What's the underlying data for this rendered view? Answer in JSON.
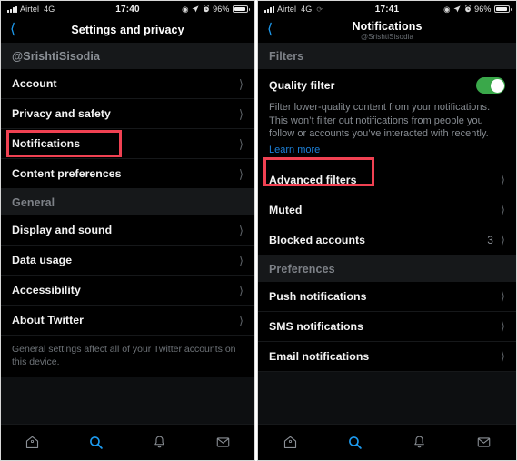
{
  "left_phone": {
    "status_bar": {
      "signal_icon": "signal-bars-icon",
      "carrier": "Airtel",
      "network": "4G",
      "time": "17:40",
      "icons": [
        "circle-icon",
        "location-arrow-icon",
        "alarm-clock-icon"
      ],
      "battery_percent": "96%",
      "battery_icon": "battery-icon"
    },
    "nav": {
      "back_icon": "chevron-left-icon",
      "title": "Settings and privacy",
      "subtitle": ""
    },
    "sections": [
      {
        "header": "@SrishtiSisodia",
        "rows": [
          {
            "label": "Account",
            "value": "",
            "accessory": "chevron-right-icon"
          },
          {
            "label": "Privacy and safety",
            "value": "",
            "accessory": "chevron-right-icon"
          },
          {
            "label": "Notifications",
            "value": "",
            "accessory": "chevron-right-icon",
            "highlighted": true
          },
          {
            "label": "Content preferences",
            "value": "",
            "accessory": "chevron-right-icon"
          }
        ]
      },
      {
        "header": "General",
        "rows": [
          {
            "label": "Display and sound",
            "value": "",
            "accessory": "chevron-right-icon"
          },
          {
            "label": "Data usage",
            "value": "",
            "accessory": "chevron-right-icon"
          },
          {
            "label": "Accessibility",
            "value": "",
            "accessory": "chevron-right-icon"
          },
          {
            "label": "About Twitter",
            "value": "",
            "accessory": "chevron-right-icon"
          }
        ]
      }
    ],
    "footer_note": "General settings affect all of your Twitter accounts on this device.",
    "tabbar": [
      {
        "icon": "home-icon",
        "active": false
      },
      {
        "icon": "search-icon",
        "active": true
      },
      {
        "icon": "bell-icon",
        "active": false
      },
      {
        "icon": "envelope-icon",
        "active": false
      }
    ]
  },
  "right_phone": {
    "status_bar": {
      "signal_icon": "signal-bars-icon",
      "carrier": "Airtel",
      "network": "4G",
      "sync_icon": "sync-icon",
      "time": "17:41",
      "icons": [
        "circle-icon",
        "location-arrow-icon",
        "alarm-clock-icon"
      ],
      "battery_percent": "96%",
      "battery_icon": "battery-icon"
    },
    "nav": {
      "back_icon": "chevron-left-icon",
      "title": "Notifications",
      "subtitle": "@SrishtiSisodia"
    },
    "filters_header": "Filters",
    "quality_filter": {
      "label": "Quality filter",
      "toggle_on": true,
      "description": "Filter lower-quality content from your notifications. This won’t filter out notifications from people you follow or accounts you’ve interacted with recently.",
      "learn_more": "Learn more"
    },
    "filter_rows": [
      {
        "label": "Advanced filters",
        "value": "",
        "accessory": "chevron-right-icon",
        "highlighted": true
      },
      {
        "label": "Muted",
        "value": "",
        "accessory": "chevron-right-icon"
      },
      {
        "label": "Blocked accounts",
        "value": "3",
        "accessory": "chevron-right-icon"
      }
    ],
    "preferences_header": "Preferences",
    "preference_rows": [
      {
        "label": "Push notifications",
        "value": "",
        "accessory": "chevron-right-icon"
      },
      {
        "label": "SMS notifications",
        "value": "",
        "accessory": "chevron-right-icon"
      },
      {
        "label": "Email notifications",
        "value": "",
        "accessory": "chevron-right-icon"
      }
    ],
    "tabbar": [
      {
        "icon": "home-icon",
        "active": false
      },
      {
        "icon": "search-icon",
        "active": true
      },
      {
        "icon": "bell-icon",
        "active": false
      },
      {
        "icon": "envelope-icon",
        "active": false
      }
    ]
  },
  "colors": {
    "background": "#000000",
    "section_header_bg": "#16181a",
    "accent_blue": "#1d9bf0",
    "toggle_green": "#3aa84a",
    "highlight_red": "#f04152",
    "muted_text": "#7d8187"
  }
}
